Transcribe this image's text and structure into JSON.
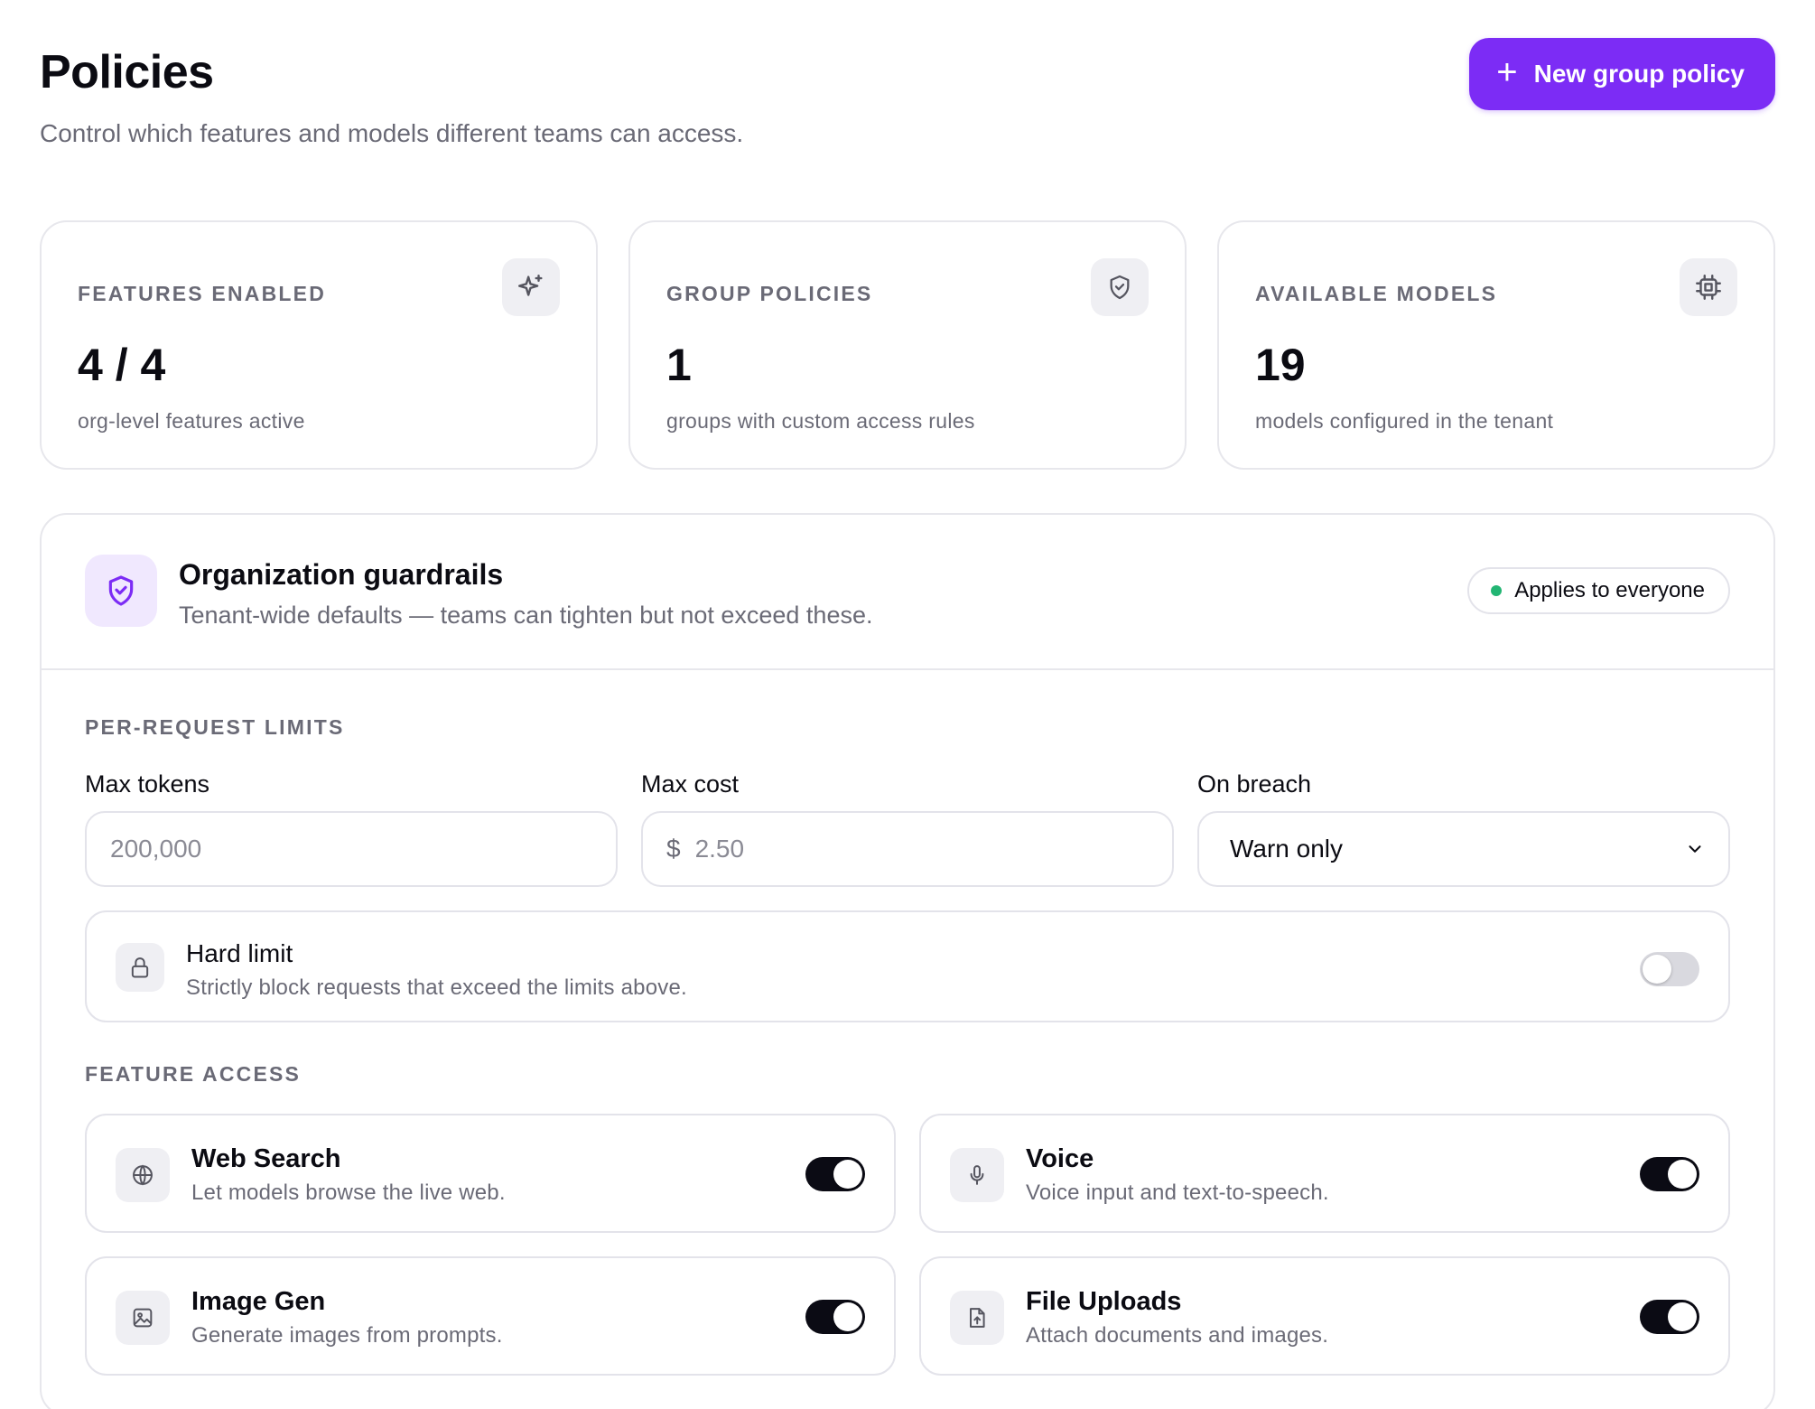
{
  "header": {
    "title": "Policies",
    "subtitle": "Control which features and models different teams can access.",
    "new_button_label": "New group policy"
  },
  "stats": [
    {
      "label": "FEATURES ENABLED",
      "value": "4 / 4",
      "caption": "org-level features active",
      "icon": "sparkles-icon"
    },
    {
      "label": "GROUP POLICIES",
      "value": "1",
      "caption": "groups with custom access rules",
      "icon": "shield-check-icon"
    },
    {
      "label": "AVAILABLE MODELS",
      "value": "19",
      "caption": "models configured in the tenant",
      "icon": "chip-icon"
    }
  ],
  "guardrails": {
    "title": "Organization guardrails",
    "subtitle": "Tenant-wide defaults — teams can tighten but not exceed these.",
    "badge": "Applies to everyone",
    "badge_dot_color": "#22b573",
    "limits_section": "PER-REQUEST LIMITS",
    "max_tokens": {
      "label": "Max tokens",
      "placeholder": "200,000",
      "value": ""
    },
    "max_cost": {
      "label": "Max cost",
      "currency": "$",
      "placeholder": "2.50",
      "value": ""
    },
    "on_breach": {
      "label": "On breach",
      "selected": "Warn only"
    },
    "hard_limit": {
      "title": "Hard limit",
      "description": "Strictly block requests that exceed the limits above.",
      "enabled": false
    },
    "feature_section": "FEATURE ACCESS",
    "features": [
      {
        "title": "Web Search",
        "description": "Let models browse the live web.",
        "icon": "globe-icon",
        "enabled": true
      },
      {
        "title": "Voice",
        "description": "Voice input and text-to-speech.",
        "icon": "microphone-icon",
        "enabled": true
      },
      {
        "title": "Image Gen",
        "description": "Generate images from prompts.",
        "icon": "image-icon",
        "enabled": true
      },
      {
        "title": "File Uploads",
        "description": "Attach documents and images.",
        "icon": "file-upload-icon",
        "enabled": true
      }
    ]
  },
  "colors": {
    "accent": "#7c2cf5",
    "toggle_on": "#0b0b14",
    "toggle_off": "#d9d9df"
  }
}
